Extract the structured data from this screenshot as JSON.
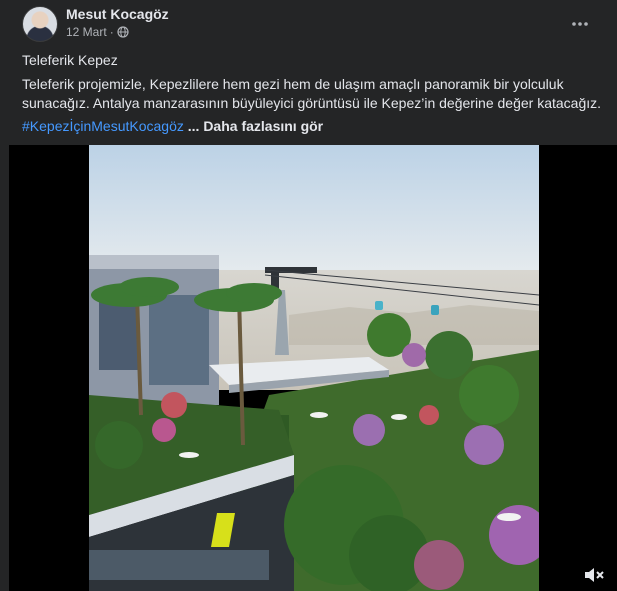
{
  "post": {
    "author": "Mesut Kocagöz",
    "date": "12 Mart",
    "date_separator": "·",
    "privacy_icon": "globe-icon",
    "more_icon": "more-options-icon",
    "title": "Teleferik Kepez",
    "body": "Teleferik projemizle, Kepezlilere hem gezi hem de ulaşım amaçlı panoramik bir yolculuk sunacağız. Antalya manzarasının büyüleyici görüntüsü ile Kepez’in değerine değer katacağız.",
    "hashtag": "#KepezİçinMesutKocagöz",
    "see_more": "... Daha fazlasını gör"
  },
  "media": {
    "type": "video",
    "mute_icon": "speaker-muted-icon"
  },
  "colors": {
    "background": "#242526",
    "text": "#e4e6eb",
    "secondary_text": "#b0b3b8",
    "link": "#4599ff"
  }
}
